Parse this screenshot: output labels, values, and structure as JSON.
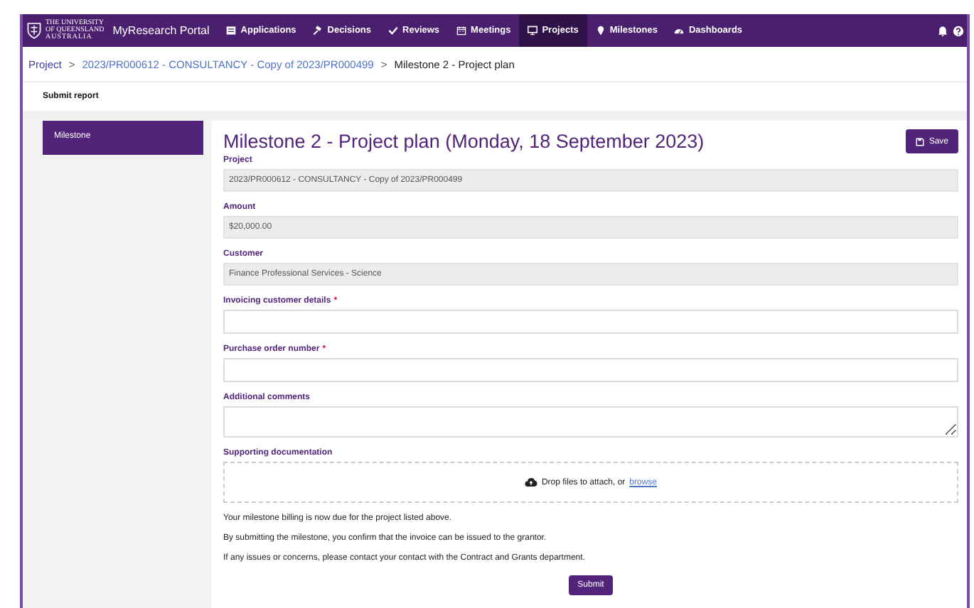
{
  "logo": {
    "line_1": "THE UNIVERSITY",
    "line_2": "OF QUEENSLAND",
    "line_3": "AUSTRALIA"
  },
  "app_title": "MyResearch Portal",
  "nav": [
    {
      "label": "Applications",
      "selected": false
    },
    {
      "label": "Decisions",
      "selected": false
    },
    {
      "label": "Reviews",
      "selected": false
    },
    {
      "label": "Meetings",
      "selected": false
    },
    {
      "label": "Projects",
      "selected": true
    },
    {
      "label": "Milestones",
      "selected": false
    },
    {
      "label": "Dashboards",
      "selected": false
    }
  ],
  "breadcrumb": [
    {
      "label": "Project",
      "kind": "root"
    },
    {
      "label": ">",
      "kind": "separator"
    },
    {
      "label": "2023/PR000612 - CONSULTANCY - Copy of 2023/PR000499",
      "kind": "link"
    },
    {
      "label": ">",
      "kind": "separator"
    },
    {
      "label": "Milestone 2 - Project plan",
      "kind": "current"
    }
  ],
  "section_title": "Submit report",
  "sidebar": [
    {
      "label": "Milestone",
      "selected": true
    }
  ],
  "form": {
    "title": "Milestone 2 - Project plan (Monday, 18 September 2023)",
    "save_button": "Save",
    "fields": [
      {
        "label": "Project",
        "kind": "readonly",
        "value": "2023/PR000612 - CONSULTANCY - Copy of 2023/PR000499"
      },
      {
        "label": "Amount",
        "kind": "readonly",
        "value": "$20,000.00"
      },
      {
        "label": "Customer",
        "kind": "readonly",
        "value": "Finance Professional Services - Science"
      },
      {
        "label": "Invoicing customer details",
        "kind": "input",
        "required_mark": "*"
      },
      {
        "label": "Purchase order number",
        "kind": "input",
        "required_mark": "*"
      },
      {
        "label": "Additional comments",
        "kind": "textarea"
      }
    ],
    "upload": {
      "label": "Supporting documentation",
      "text": "Drop files to attach, or",
      "link": "browse"
    },
    "notes": [
      "Your milestone billing is now due for the project listed above.",
      "By submitting the milestone, you confirm that the invoice can be issued to the grantor.",
      "If any issues or concerns, please contact your contact with the Contract and Grants department."
    ],
    "submit_button": "Submit"
  }
}
